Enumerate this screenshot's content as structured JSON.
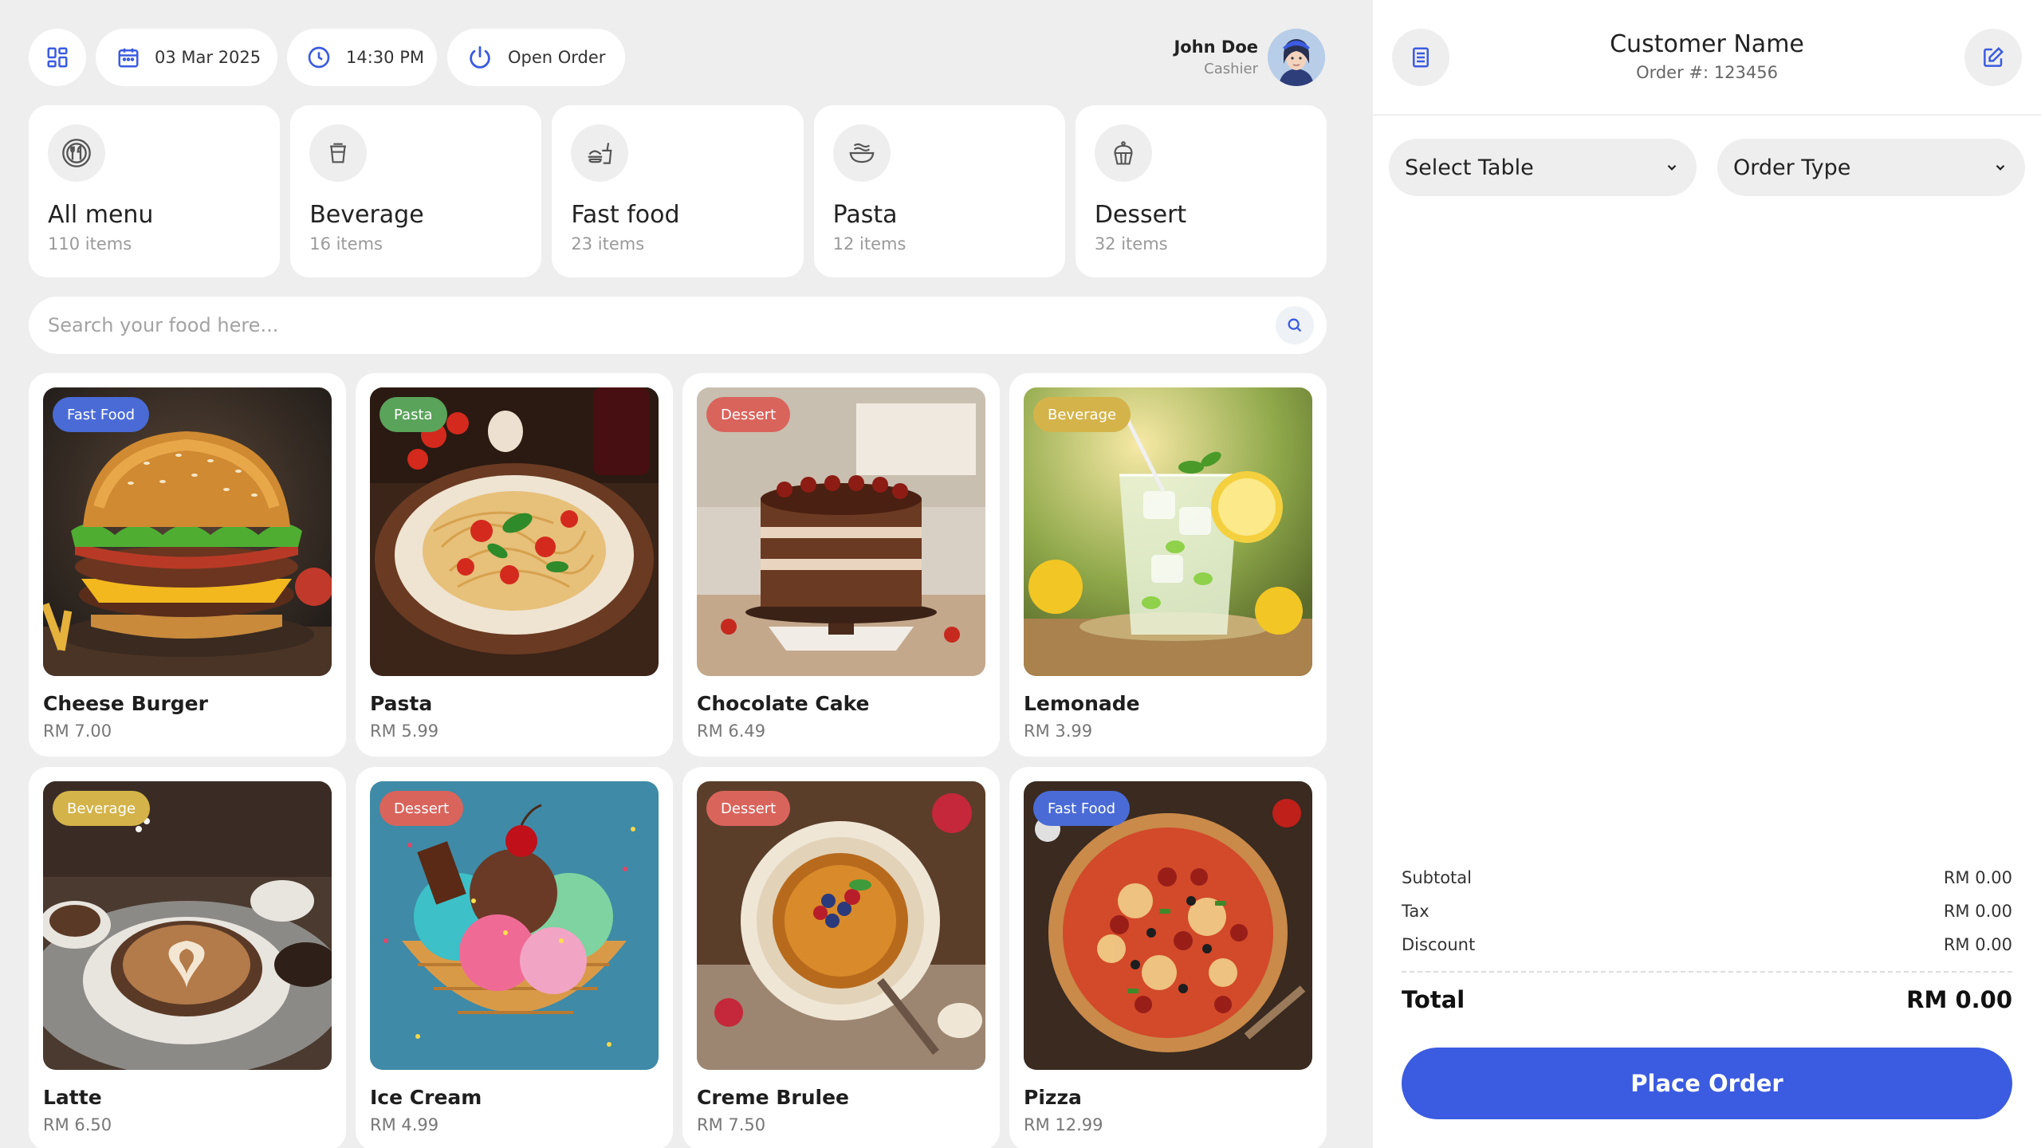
{
  "topbar": {
    "date": "03 Mar 2025",
    "time": "14:30 PM",
    "open_order_label": "Open Order"
  },
  "user": {
    "name": "John Doe",
    "role": "Cashier"
  },
  "categories": [
    {
      "title": "All menu",
      "count": "110 items",
      "icon": "utensils-icon"
    },
    {
      "title": "Beverage",
      "count": "16 items",
      "icon": "cup-icon"
    },
    {
      "title": "Fast food",
      "count": "23 items",
      "icon": "fastfood-icon"
    },
    {
      "title": "Pasta",
      "count": "12 items",
      "icon": "noodle-bowl-icon"
    },
    {
      "title": "Dessert",
      "count": "32 items",
      "icon": "cupcake-icon"
    }
  ],
  "search": {
    "placeholder": "Search your food here..."
  },
  "products": [
    {
      "name": "Cheese Burger",
      "price": "RM 7.00",
      "badge": "Fast Food"
    },
    {
      "name": "Pasta",
      "price": "RM 5.99",
      "badge": "Pasta"
    },
    {
      "name": "Chocolate Cake",
      "price": "RM 6.49",
      "badge": "Dessert"
    },
    {
      "name": "Lemonade",
      "price": "RM 3.99",
      "badge": "Beverage"
    },
    {
      "name": "Latte",
      "price": "RM 6.50",
      "badge": "Beverage"
    },
    {
      "name": "Ice Cream",
      "price": "RM 4.99",
      "badge": "Dessert"
    },
    {
      "name": "Creme Brulee",
      "price": "RM 7.50",
      "badge": "Dessert"
    },
    {
      "name": "Pizza",
      "price": "RM 12.99",
      "badge": "Fast Food"
    }
  ],
  "badge_colors": {
    "Fast Food": "#4a6bd6",
    "Pasta": "#5aa35a",
    "Dessert": "#d9645c",
    "Beverage": "#d4b34a"
  },
  "order": {
    "customer_name": "Customer Name",
    "order_number": "Order #: 123456",
    "select_table": "Select Table",
    "order_type": "Order Type"
  },
  "summary": {
    "subtotal_label": "Subtotal",
    "subtotal": "RM 0.00",
    "tax_label": "Tax",
    "tax": "RM 0.00",
    "discount_label": "Discount",
    "discount": "RM 0.00",
    "total_label": "Total",
    "total": "RM 0.00"
  },
  "place_order_label": "Place Order",
  "colors": {
    "accent": "#3b5be0",
    "background": "#eeeeee"
  }
}
